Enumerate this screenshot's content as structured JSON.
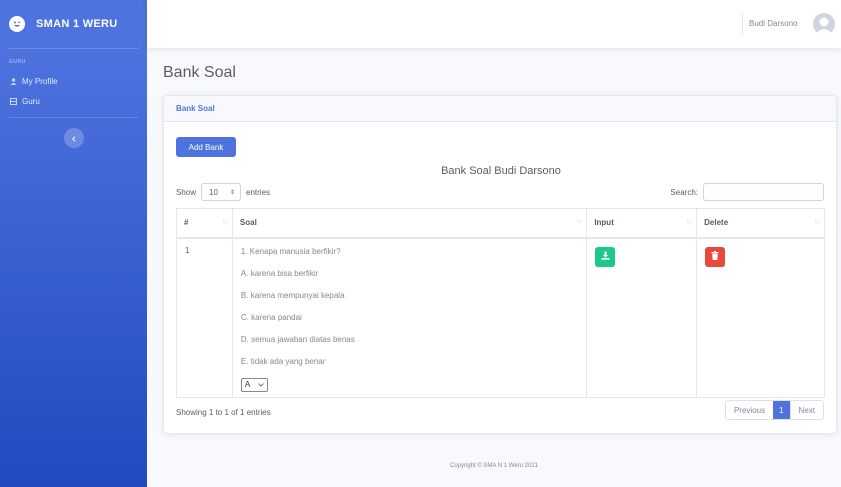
{
  "sidebar": {
    "brand": "SMAN 1 WERU",
    "heading": "GURU",
    "items": [
      {
        "label": "My Profile",
        "icon": "user-icon"
      },
      {
        "label": "Guru",
        "icon": "table-icon"
      }
    ]
  },
  "topbar": {
    "user_name": "Budi Darsono"
  },
  "page": {
    "title": "Bank Soal"
  },
  "card": {
    "header": "Bank Soal",
    "add_button": "Add Bank",
    "table_title": "Bank Soal Budi Darsono",
    "show_label": "Show",
    "entries_label": "entries",
    "page_length": "10",
    "search_label": "Search:",
    "search_value": "",
    "columns": [
      "#",
      "Soal",
      "Input",
      "Delete"
    ],
    "rows": [
      {
        "no": "1",
        "question": "1. Kenapa manusia berfikir?",
        "options": [
          "A. karena bisa berfikir",
          "B. karena mempunyai kepala",
          "C. karena pandai",
          "D. semua jawaban diatas benas",
          "E. tidak ada yang benar"
        ],
        "answer": "A"
      }
    ],
    "info": "Showing 1 to 1 of 1 entries",
    "pagination": {
      "previous": "Previous",
      "current": "1",
      "next": "Next"
    }
  },
  "footer": "Copyright © SMA N 1 Weru 2021",
  "colors": {
    "primary": "#4e73df",
    "success": "#1cc88a",
    "danger": "#e74a3b"
  }
}
